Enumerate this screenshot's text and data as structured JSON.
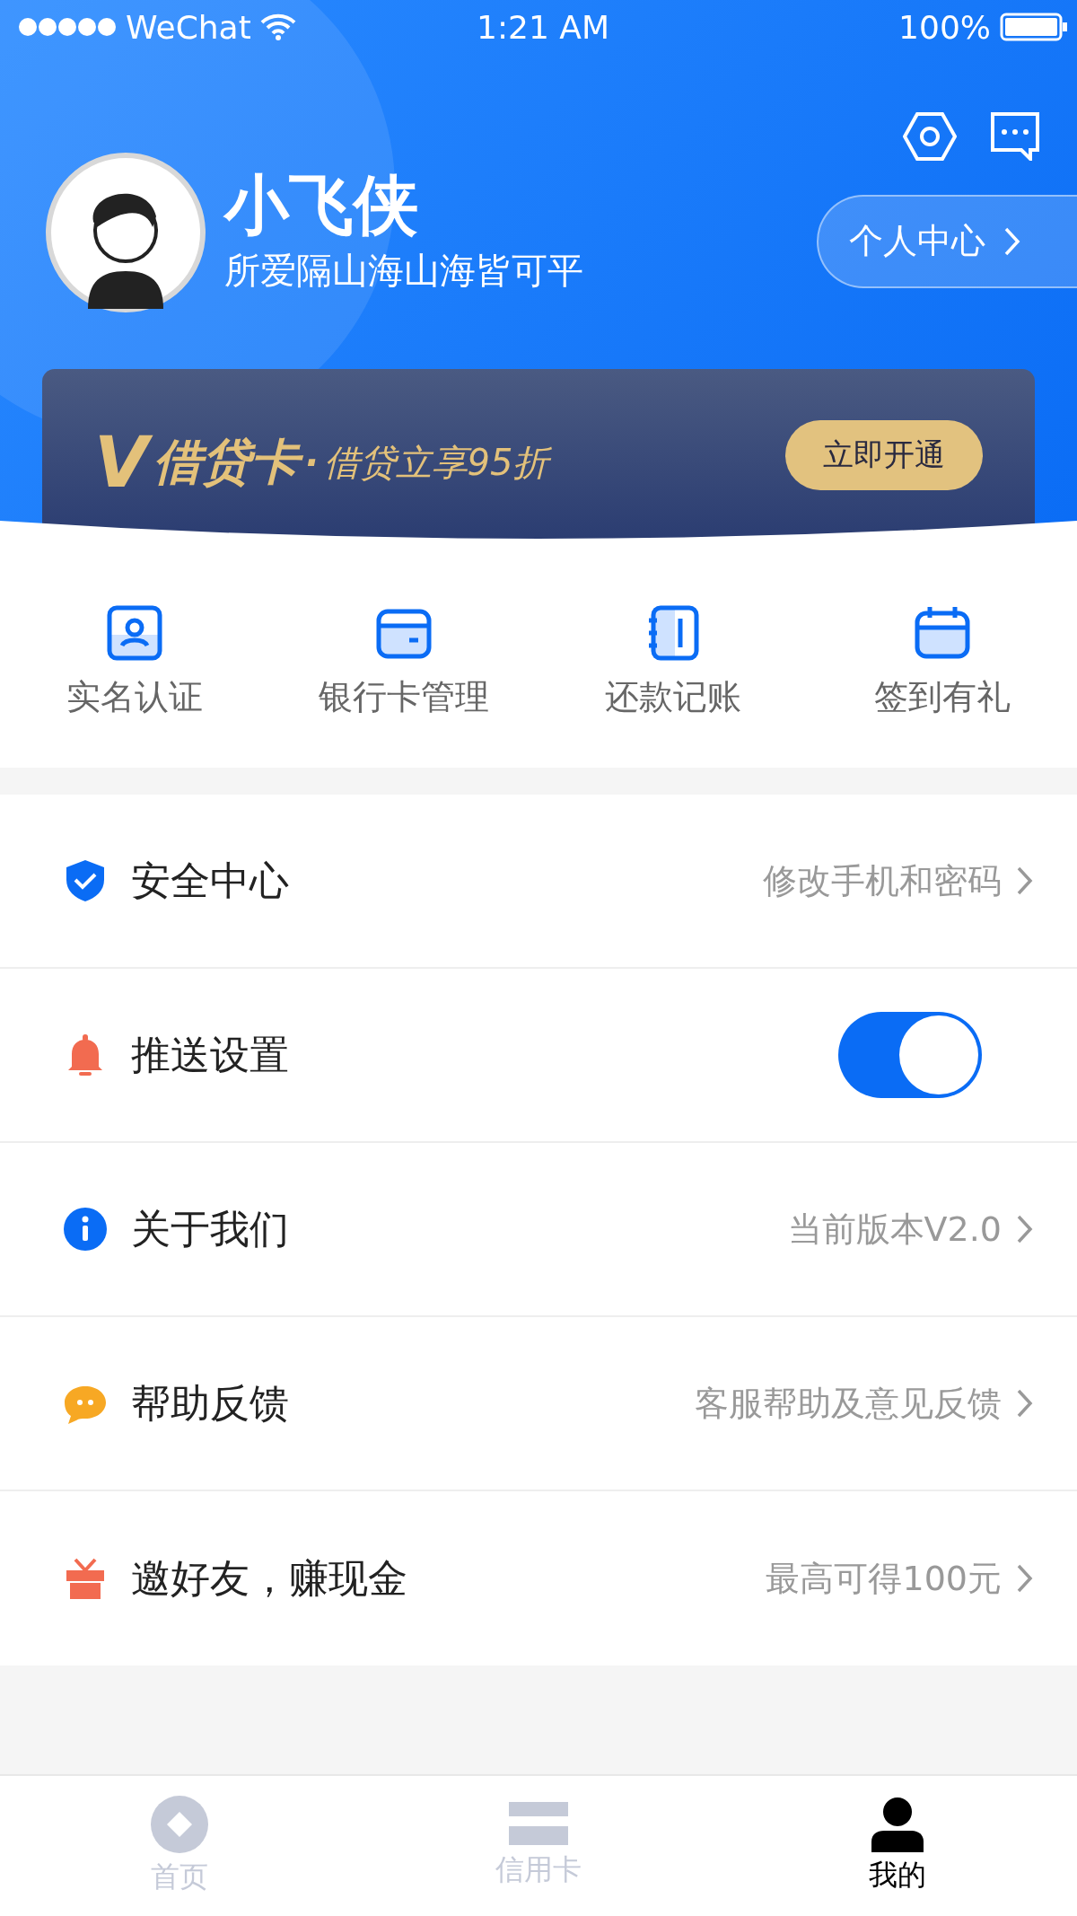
{
  "status_bar": {
    "carrier": "WeChat",
    "time": "1:21 AM",
    "battery": "100%"
  },
  "profile": {
    "name": "小飞侠",
    "motto": "所爱隔山海山海皆可平",
    "center_button": "个人中心"
  },
  "banner": {
    "logo": "V",
    "title": "借贷卡",
    "dot": "·",
    "subtitle": "借贷立享95折",
    "button": "立即开通"
  },
  "shortcuts": [
    {
      "label": "实名认证"
    },
    {
      "label": "银行卡管理"
    },
    {
      "label": "还款记账"
    },
    {
      "label": "签到有礼"
    }
  ],
  "menu": [
    {
      "kind": "link",
      "label": "安全中心",
      "value": "修改手机和密码"
    },
    {
      "kind": "toggle",
      "label": "推送设置",
      "on": true
    },
    {
      "kind": "link",
      "label": "关于我们",
      "value": "当前版本V2.0"
    },
    {
      "kind": "link",
      "label": "帮助反馈",
      "value": "客服帮助及意见反馈"
    },
    {
      "kind": "link",
      "label": "邀好友，赚现金",
      "value": "最高可得100元"
    }
  ],
  "tabs": [
    {
      "label": "首页",
      "selected": false
    },
    {
      "label": "信用卡",
      "selected": false
    },
    {
      "label": "我的",
      "selected": true
    }
  ]
}
